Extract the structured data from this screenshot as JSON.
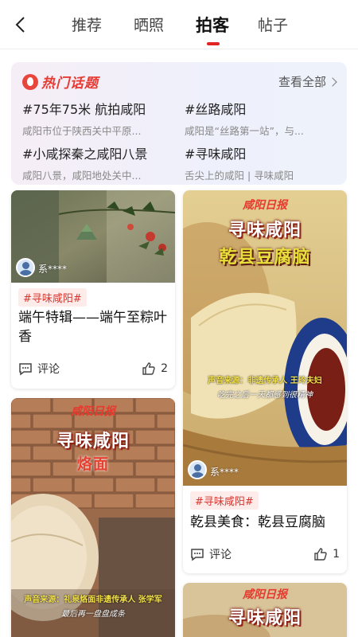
{
  "header": {
    "tabs": [
      {
        "label": "推荐"
      },
      {
        "label": "晒照"
      },
      {
        "label": "拍客"
      },
      {
        "label": "帖子"
      }
    ],
    "active_tab": "拍客"
  },
  "hot_topics": {
    "title": "热门话题",
    "see_all": "查看全部",
    "items": [
      {
        "name": "#75年75米 航拍咸阳",
        "desc": "咸阳市位于陕西关中平原..."
      },
      {
        "name": "#丝路咸阳",
        "desc": "咸阳是“丝路第一站”，与..."
      },
      {
        "name": "#小咸探秦之咸阳八景",
        "desc": "咸阳八景，咸阳地处关中..."
      },
      {
        "name": "#寻味咸阳",
        "desc": "舌尖上的咸阳 | 寻味咸阳"
      }
    ]
  },
  "feed": [
    {
      "tag": "#寻味咸阳#",
      "author": "系****",
      "title": "端午特辑——端午至粽叶香",
      "comment_label": "评论",
      "likes": "2"
    },
    {
      "tag": "#寻味咸阳#",
      "author": "系****",
      "title": "乾县美食：乾县豆腐脑",
      "comment_label": "评论",
      "likes": "1",
      "cover": {
        "brand": "咸阳日报",
        "line1": "寻味咸阳",
        "line2": "乾县豆腐脑",
        "caption1": "声音来源：非遗传承人 王玲夫妇",
        "caption2": "吃完之后一天都感到很精神"
      }
    },
    {
      "cover": {
        "brand": "咸阳日报",
        "line1": "寻味咸阳",
        "line2": "烙面",
        "caption1": "声音来源：礼泉烙面非遗传承人 张学军",
        "caption2": "最后再一盘盘成条"
      }
    },
    {
      "cover": {
        "brand": "咸阳日报",
        "line1": "寻味咸阳"
      }
    }
  ],
  "colors": {
    "accent": "#e02424",
    "tag_text": "#d9362f",
    "tag_bg": "#fdecea"
  }
}
